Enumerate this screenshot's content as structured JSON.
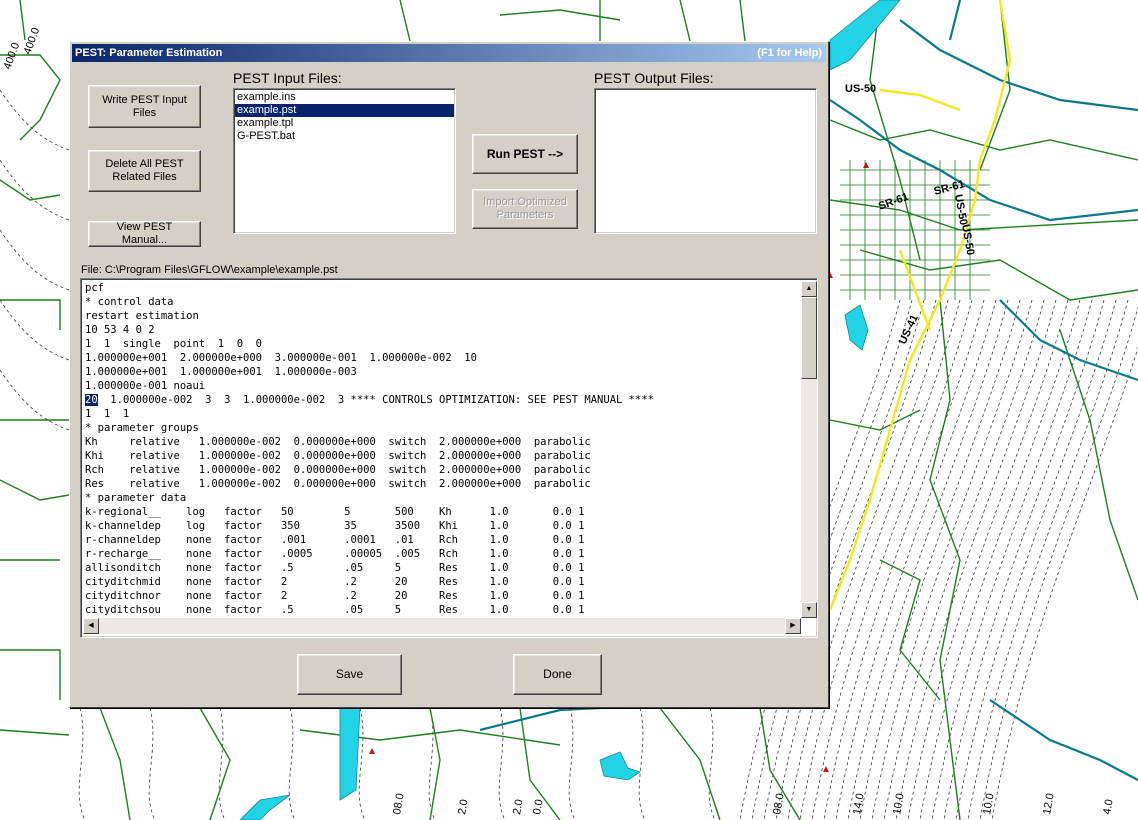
{
  "window": {
    "title": "PEST: Parameter Estimation",
    "help_hint": "(F1 for Help)"
  },
  "buttons": {
    "write_pest": "Write PEST Input\nFiles",
    "delete_pest": "Delete All PEST\nRelated Files",
    "view_manual": "View PEST Manual...",
    "run_pest": "Run PEST -->",
    "import_params": "Import Optimized\nParameters",
    "save": "Save",
    "done": "Done"
  },
  "input_files": {
    "label": "PEST Input Files:",
    "items": [
      "example.ins",
      "example.pst",
      "example.tpl",
      "G-PEST.bat"
    ],
    "selected": "example.pst"
  },
  "output_files": {
    "label": "PEST Output Files:",
    "items": []
  },
  "file_path": "File: C:\\Program Files\\GFLOW\\example\\example.pst",
  "editor": {
    "lines": [
      "pcf",
      "* control data",
      "restart estimation",
      "10 53 4 0 2",
      "1  1  single  point  1  0  0",
      "1.000000e+001  2.000000e+000  3.000000e-001  1.000000e-002  10",
      "1.000000e+001  1.000000e+001  1.000000e-003",
      "1.000000e-001 noaui",
      "20  1.000000e-002  3  3  1.000000e-002  3 **** CONTROLS OPTIMIZATION: SEE PEST MANUAL ****",
      "1  1  1",
      "* parameter groups",
      "Kh     relative   1.000000e-002  0.000000e+000  switch  2.000000e+000  parabolic",
      "Khi    relative   1.000000e-002  0.000000e+000  switch  2.000000e+000  parabolic",
      "Rch    relative   1.000000e-002  0.000000e+000  switch  2.000000e+000  parabolic",
      "Res    relative   1.000000e-002  0.000000e+000  switch  2.000000e+000  parabolic",
      "* parameter data",
      "k-regional__    log   factor   50        5       500    Kh      1.0       0.0 1",
      "k-channeldep    log   factor   350       35      3500   Khi     1.0       0.0 1",
      "r-channeldep    none  factor   .001      .0001   .01    Rch     1.0       0.0 1",
      "r-recharge__    none  factor   .0005     .00005  .005   Rch     1.0       0.0 1",
      "allisonditch    none  factor   .5        .05     5      Res     1.0       0.0 1",
      "cityditchmid    none  factor   2         .2      20     Res     1.0       0.0 1",
      "cityditchnor    none  factor   2         .2      20     Res     1.0       0.0 1",
      "cityditchsou    none  factor   .5        .05     5      Res     1.0       0.0 1"
    ],
    "highlighted_token": "20",
    "highlight_line_index": 8
  },
  "map": {
    "road_labels": [
      "US-50",
      "SR-61",
      "US-50",
      "US-50",
      "US-41",
      "SR-61"
    ],
    "contour_labels": [
      "400.0",
      "400.0",
      "2.0",
      "0.0",
      "2.0",
      "08.0",
      "08.0",
      "14.0",
      "10.0",
      "10.0",
      "12.0",
      "4.0"
    ],
    "colors": {
      "stream": "#0a7a8a",
      "river_cyan": "#22d3e6",
      "road_green": "#1e7e1e",
      "highway": "#f2ea1c",
      "contour": "#222222"
    }
  }
}
